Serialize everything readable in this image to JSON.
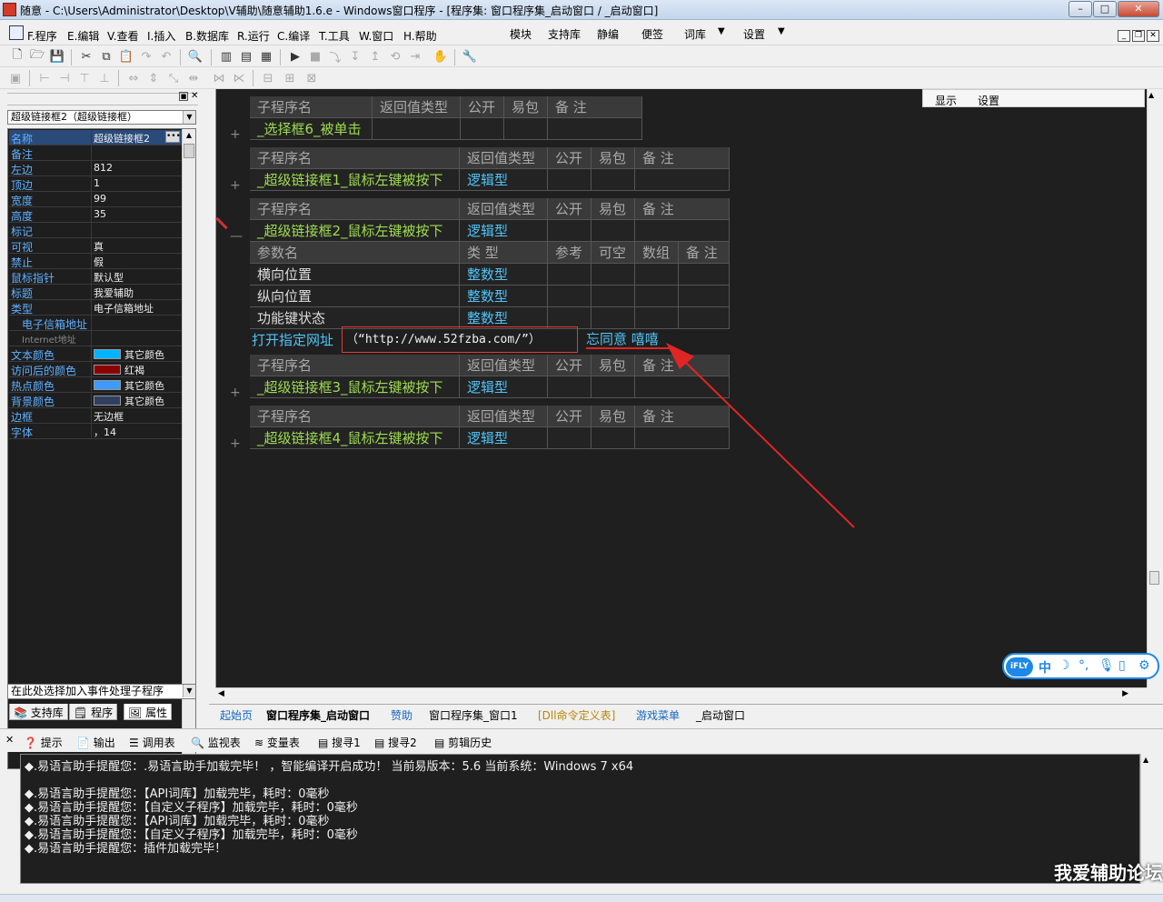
{
  "window": {
    "title": "随意 - C:\\Users\\Administrator\\Desktop\\V辅助\\随意辅助1.6.e - Windows窗口程序 - [程序集: 窗口程序集_启动窗口 / _启动窗口]"
  },
  "menu": {
    "items": [
      "F.程序",
      "E.编辑",
      "V.查看",
      "I.插入",
      "B.数据库",
      "R.运行",
      "C.编译",
      "T.工具",
      "W.窗口",
      "H.帮助"
    ],
    "right_items": [
      "模块",
      "支持库",
      "静编",
      "便签",
      "词库",
      "设置"
    ]
  },
  "left_panel": {
    "combo_value": "超级链接框2（超级链接框）",
    "properties": [
      {
        "name": "名称",
        "value": "超级链接框2"
      },
      {
        "name": "备注",
        "value": ""
      },
      {
        "name": "左边",
        "value": "812"
      },
      {
        "name": "顶边",
        "value": "1"
      },
      {
        "name": "宽度",
        "value": "99"
      },
      {
        "name": "高度",
        "value": "35"
      },
      {
        "name": "标记",
        "value": ""
      },
      {
        "name": "可视",
        "value": "真"
      },
      {
        "name": "禁止",
        "value": "假"
      },
      {
        "name": "鼠标指针",
        "value": "默认型"
      },
      {
        "name": "标题",
        "value": "我爱辅助"
      },
      {
        "name": "类型",
        "value": "电子信箱地址"
      },
      {
        "name": "电子信箱地址",
        "value": ""
      },
      {
        "name": "Internet地址",
        "value": ""
      },
      {
        "name": "文本颜色",
        "value": "其它颜色"
      },
      {
        "name": "访问后的颜色",
        "value": "红褐"
      },
      {
        "name": "热点颜色",
        "value": "其它颜色"
      },
      {
        "name": "背景颜色",
        "value": "其它颜色"
      },
      {
        "name": "边框",
        "value": "无边框"
      },
      {
        "name": "字体",
        "value": "，14"
      }
    ],
    "swatch_colors": {
      "text": "#00b4ff",
      "visited": "#8b0000",
      "hot": "#3d9bff",
      "bg": "#2f3f5f"
    },
    "event_combo": "在此处选择加入事件处理子程序",
    "tabs": [
      "支持库",
      "程序",
      "属性"
    ]
  },
  "editor": {
    "topright": [
      "显示",
      "设置"
    ],
    "header_cols": {
      "name": "子程序名",
      "ret": "返回值类型",
      "pub": "公开",
      "easy": "易包",
      "note": "备 注"
    },
    "param_cols": {
      "name": "参数名",
      "type": "类 型",
      "ref": "参考",
      "nullable": "可空",
      "array": "数组",
      "note": "备 注"
    },
    "subs": [
      {
        "name": "_选择框6_被单击",
        "ret": ""
      },
      {
        "name": "_超级链接框1_鼠标左键被按下",
        "ret": "逻辑型"
      },
      {
        "name": "_超级链接框2_鼠标左键被按下",
        "ret": "逻辑型"
      },
      {
        "name": "_超级链接框3_鼠标左键被按下",
        "ret": "逻辑型"
      },
      {
        "name": "_超级链接框4_鼠标左键被按下",
        "ret": "逻辑型"
      }
    ],
    "params": [
      {
        "name": "横向位置",
        "type": "整数型"
      },
      {
        "name": "纵向位置",
        "type": "整数型"
      },
      {
        "name": "功能键状态",
        "type": "整数型"
      }
    ],
    "code_line": {
      "command": "打开指定网址",
      "args": "（“http://www.52fzba.com/”）"
    },
    "annotation": "忘同意 嘻嘻"
  },
  "editor_tabs": [
    "起始页",
    "窗口程序集_启动窗口",
    "赞助",
    "窗口程序集_窗口1",
    "[Dll命令定义表]",
    "游戏菜单",
    "_启动窗口"
  ],
  "output_tabs": [
    "提示",
    "输出",
    "调用表",
    "监视表",
    "变量表",
    "搜寻1",
    "搜寻2",
    "剪辑历史"
  ],
  "output_lines": [
    "◆.易语言助手提醒您：.易语言助手加载完毕！  ，智能编译开启成功！  当前易版本：5.6  当前系统：Windows 7 x64",
    "",
    "◆.易语言助手提醒您：【API词库】加载完毕，耗时：0毫秒",
    "◆.易语言助手提醒您：【自定义子程序】加载完毕，耗时：0毫秒",
    "◆.易语言助手提醒您：【API词库】加载完毕，耗时：0毫秒",
    "◆.易语言助手提醒您：【自定义子程序】加载完毕，耗时：0毫秒",
    "◆.易语言助手提醒您：插件加载完毕！"
  ],
  "ime": {
    "logo": "iFLY",
    "mode": "中"
  },
  "watermark": "我爱辅助论坛"
}
